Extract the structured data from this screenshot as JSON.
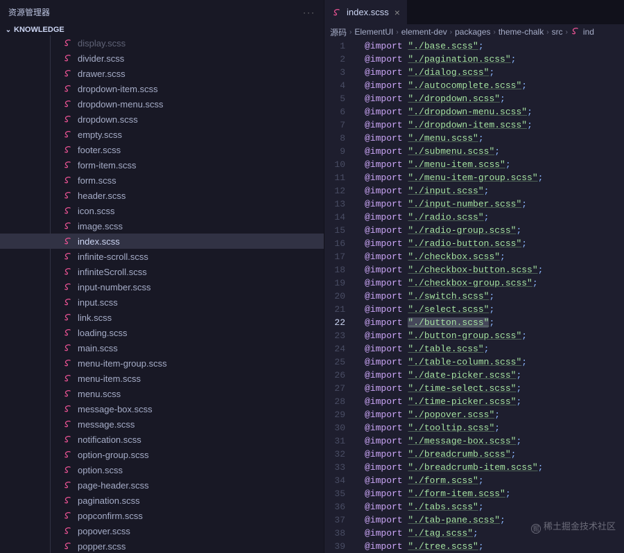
{
  "sidebar": {
    "title": "资源管理器",
    "section": "KNOWLEDGE",
    "selected": "index.scss",
    "files": [
      "display.scss",
      "divider.scss",
      "drawer.scss",
      "dropdown-item.scss",
      "dropdown-menu.scss",
      "dropdown.scss",
      "empty.scss",
      "footer.scss",
      "form-item.scss",
      "form.scss",
      "header.scss",
      "icon.scss",
      "image.scss",
      "index.scss",
      "infinite-scroll.scss",
      "infiniteScroll.scss",
      "input-number.scss",
      "input.scss",
      "link.scss",
      "loading.scss",
      "main.scss",
      "menu-item-group.scss",
      "menu-item.scss",
      "menu.scss",
      "message-box.scss",
      "message.scss",
      "notification.scss",
      "option-group.scss",
      "option.scss",
      "page-header.scss",
      "pagination.scss",
      "popconfirm.scss",
      "popover.scss",
      "popper.scss"
    ]
  },
  "tab": {
    "filename": "index.scss"
  },
  "breadcrumbs": [
    "源码",
    "ElementUI",
    "element-dev",
    "packages",
    "theme-chalk",
    "src",
    "ind"
  ],
  "editor": {
    "currentLine": 22,
    "imports": [
      "./base.scss",
      "./pagination.scss",
      "./dialog.scss",
      "./autocomplete.scss",
      "./dropdown.scss",
      "./dropdown-menu.scss",
      "./dropdown-item.scss",
      "./menu.scss",
      "./submenu.scss",
      "./menu-item.scss",
      "./menu-item-group.scss",
      "./input.scss",
      "./input-number.scss",
      "./radio.scss",
      "./radio-group.scss",
      "./radio-button.scss",
      "./checkbox.scss",
      "./checkbox-button.scss",
      "./checkbox-group.scss",
      "./switch.scss",
      "./select.scss",
      "./button.scss",
      "./button-group.scss",
      "./table.scss",
      "./table-column.scss",
      "./date-picker.scss",
      "./time-select.scss",
      "./time-picker.scss",
      "./popover.scss",
      "./tooltip.scss",
      "./message-box.scss",
      "./breadcrumb.scss",
      "./breadcrumb-item.scss",
      "./form.scss",
      "./form-item.scss",
      "./tabs.scss",
      "./tab-pane.scss",
      "./tag.scss",
      "./tree.scss"
    ]
  },
  "watermark": "稀土掘金技术社区"
}
